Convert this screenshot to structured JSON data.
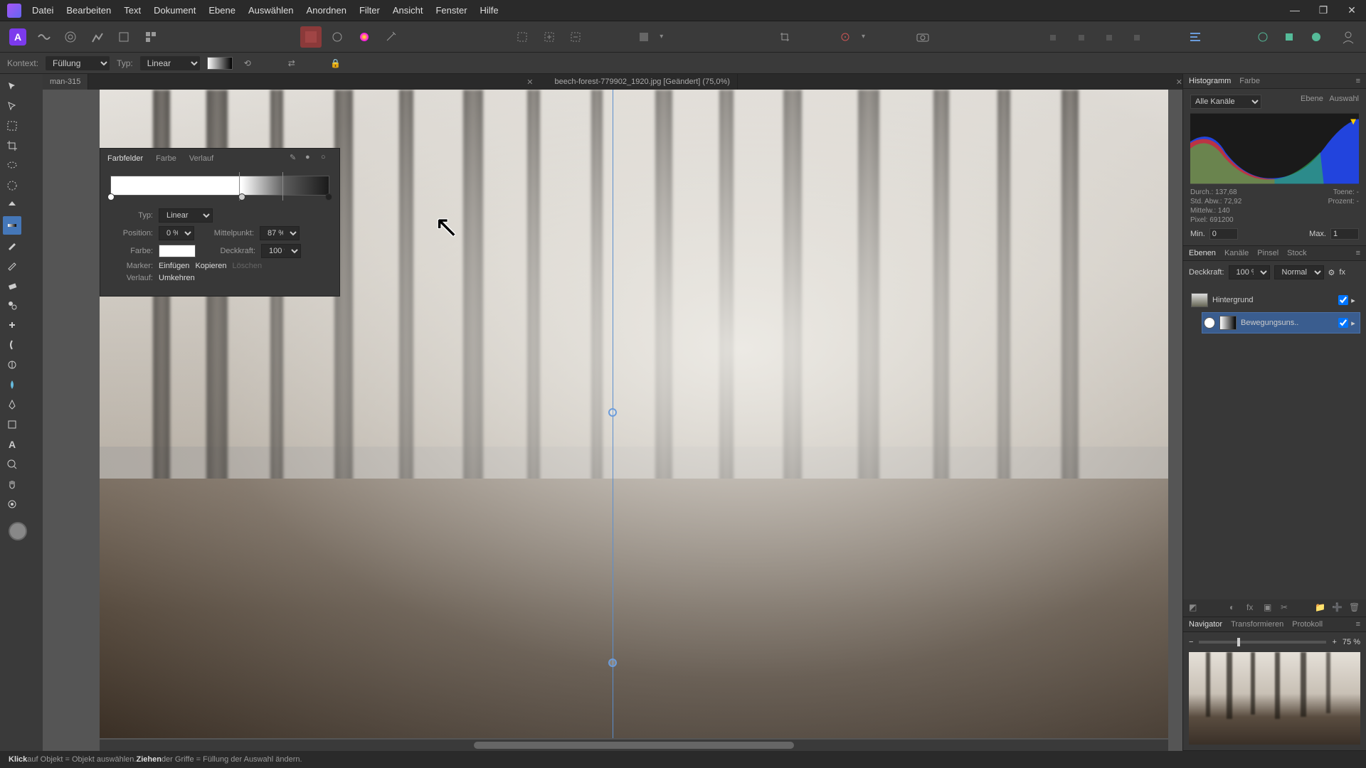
{
  "menu": [
    "Datei",
    "Bearbeiten",
    "Text",
    "Dokument",
    "Ebene",
    "Auswählen",
    "Anordnen",
    "Filter",
    "Ansicht",
    "Fenster",
    "Hilfe"
  ],
  "context": {
    "label": "Kontext:",
    "fill_label": "Füllung",
    "type_label": "Typ:",
    "type_value": "Linear"
  },
  "tabs": [
    {
      "label": "man-315",
      "active": false
    },
    {
      "label": "beech-forest-779902_1920.jpg [Geändert] (75,0%)",
      "active": true
    }
  ],
  "gradient_popup": {
    "tabs": [
      "Farbfelder",
      "Farbe",
      "Verlauf"
    ],
    "active_tab": "Farbfelder",
    "stops": [
      {
        "pos": 0
      },
      {
        "pos": 60
      },
      {
        "pos": 80
      },
      {
        "pos": 100
      }
    ],
    "type_label": "Typ:",
    "type_value": "Linear",
    "position_label": "Position:",
    "position_value": "0 %",
    "midpoint_label": "Mittelpunkt:",
    "midpoint_value": "87 %",
    "color_label": "Farbe:",
    "opacity_label": "Deckkraft:",
    "opacity_value": "100 %",
    "marker_label": "Marker:",
    "insert": "Einfügen",
    "copy": "Kopieren",
    "delete": "Löschen",
    "gradient_label": "Verlauf:",
    "reverse": "Umkehren"
  },
  "histogram": {
    "tabs": [
      "Histogramm",
      "Farbe"
    ],
    "channels": "Alle Kanäle",
    "ebene": "Ebene",
    "auswahl": "Auswahl",
    "durch_l": "Durch.:",
    "durch_v": "137,68",
    "std_l": "Std. Abw.:",
    "std_v": "72,92",
    "mittel_l": "Mittelw.:",
    "mittel_v": "140",
    "pixel_l": "Pixel:",
    "pixel_v": "691200",
    "toene_l": "Toene:",
    "toene_v": "-",
    "prozent_l": "Prozent:",
    "prozent_v": "-",
    "min_l": "Min.",
    "min_v": "0",
    "max_l": "Max.",
    "max_v": "1"
  },
  "layers": {
    "tabs": [
      "Ebenen",
      "Kanäle",
      "Pinsel",
      "Stock"
    ],
    "opacity_label": "Deckkraft:",
    "opacity": "100 %",
    "blend": "Normal",
    "items": [
      {
        "name": "Hintergrund",
        "child": false,
        "selected": false
      },
      {
        "name": "Bewegungsuns..",
        "child": true,
        "selected": true
      }
    ]
  },
  "navigator": {
    "tabs": [
      "Navigator",
      "Transformieren",
      "Protokoll"
    ],
    "zoom": "75 %"
  },
  "status": {
    "klick": "Klick",
    "klick_txt": " auf Objekt = Objekt auswählen. ",
    "ziehen": "Ziehen",
    "ziehen_txt": " der Griffe = Füllung der Auswahl ändern."
  }
}
